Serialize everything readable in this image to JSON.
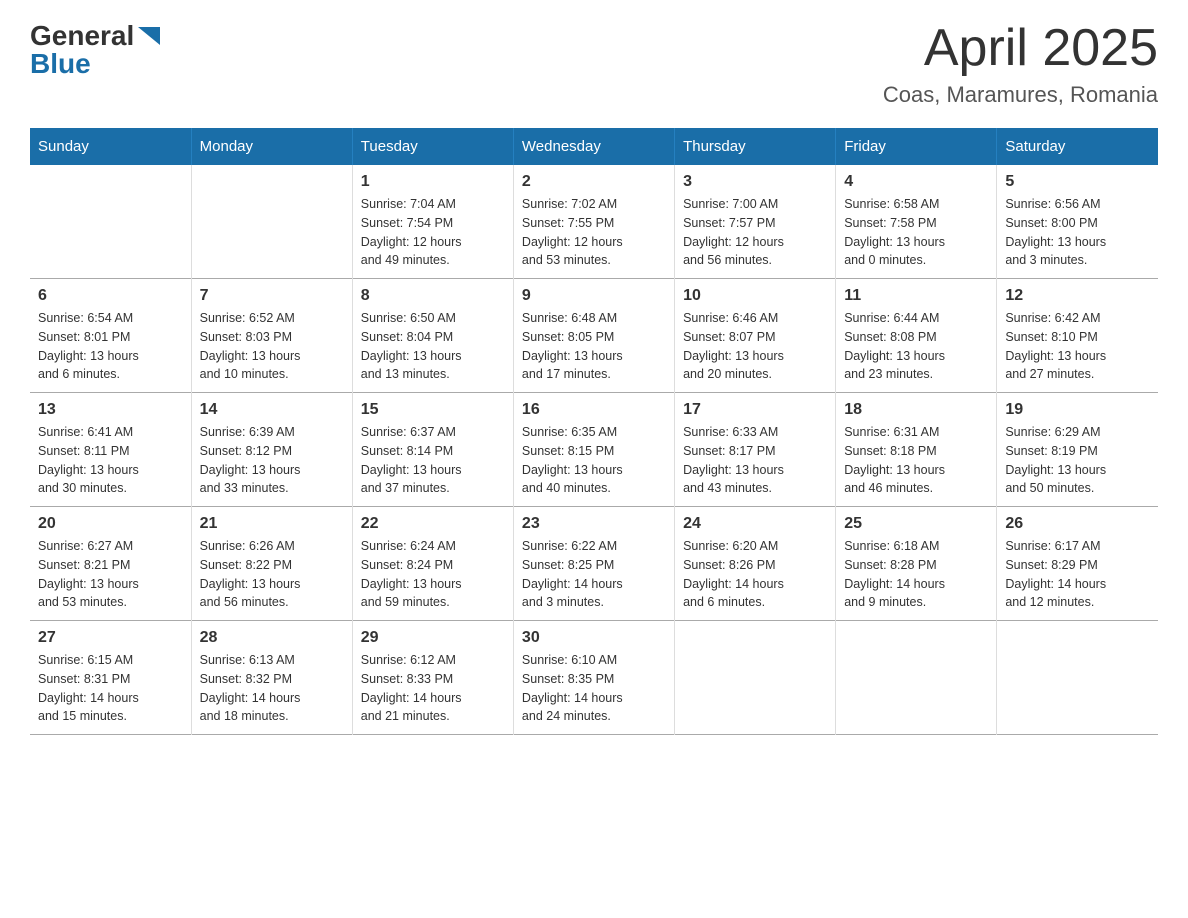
{
  "logo": {
    "general": "General",
    "blue": "Blue"
  },
  "title": "April 2025",
  "subtitle": "Coas, Maramures, Romania",
  "days_header": [
    "Sunday",
    "Monday",
    "Tuesday",
    "Wednesday",
    "Thursday",
    "Friday",
    "Saturday"
  ],
  "weeks": [
    [
      {
        "day": "",
        "info": ""
      },
      {
        "day": "",
        "info": ""
      },
      {
        "day": "1",
        "info": "Sunrise: 7:04 AM\nSunset: 7:54 PM\nDaylight: 12 hours\nand 49 minutes."
      },
      {
        "day": "2",
        "info": "Sunrise: 7:02 AM\nSunset: 7:55 PM\nDaylight: 12 hours\nand 53 minutes."
      },
      {
        "day": "3",
        "info": "Sunrise: 7:00 AM\nSunset: 7:57 PM\nDaylight: 12 hours\nand 56 minutes."
      },
      {
        "day": "4",
        "info": "Sunrise: 6:58 AM\nSunset: 7:58 PM\nDaylight: 13 hours\nand 0 minutes."
      },
      {
        "day": "5",
        "info": "Sunrise: 6:56 AM\nSunset: 8:00 PM\nDaylight: 13 hours\nand 3 minutes."
      }
    ],
    [
      {
        "day": "6",
        "info": "Sunrise: 6:54 AM\nSunset: 8:01 PM\nDaylight: 13 hours\nand 6 minutes."
      },
      {
        "day": "7",
        "info": "Sunrise: 6:52 AM\nSunset: 8:03 PM\nDaylight: 13 hours\nand 10 minutes."
      },
      {
        "day": "8",
        "info": "Sunrise: 6:50 AM\nSunset: 8:04 PM\nDaylight: 13 hours\nand 13 minutes."
      },
      {
        "day": "9",
        "info": "Sunrise: 6:48 AM\nSunset: 8:05 PM\nDaylight: 13 hours\nand 17 minutes."
      },
      {
        "day": "10",
        "info": "Sunrise: 6:46 AM\nSunset: 8:07 PM\nDaylight: 13 hours\nand 20 minutes."
      },
      {
        "day": "11",
        "info": "Sunrise: 6:44 AM\nSunset: 8:08 PM\nDaylight: 13 hours\nand 23 minutes."
      },
      {
        "day": "12",
        "info": "Sunrise: 6:42 AM\nSunset: 8:10 PM\nDaylight: 13 hours\nand 27 minutes."
      }
    ],
    [
      {
        "day": "13",
        "info": "Sunrise: 6:41 AM\nSunset: 8:11 PM\nDaylight: 13 hours\nand 30 minutes."
      },
      {
        "day": "14",
        "info": "Sunrise: 6:39 AM\nSunset: 8:12 PM\nDaylight: 13 hours\nand 33 minutes."
      },
      {
        "day": "15",
        "info": "Sunrise: 6:37 AM\nSunset: 8:14 PM\nDaylight: 13 hours\nand 37 minutes."
      },
      {
        "day": "16",
        "info": "Sunrise: 6:35 AM\nSunset: 8:15 PM\nDaylight: 13 hours\nand 40 minutes."
      },
      {
        "day": "17",
        "info": "Sunrise: 6:33 AM\nSunset: 8:17 PM\nDaylight: 13 hours\nand 43 minutes."
      },
      {
        "day": "18",
        "info": "Sunrise: 6:31 AM\nSunset: 8:18 PM\nDaylight: 13 hours\nand 46 minutes."
      },
      {
        "day": "19",
        "info": "Sunrise: 6:29 AM\nSunset: 8:19 PM\nDaylight: 13 hours\nand 50 minutes."
      }
    ],
    [
      {
        "day": "20",
        "info": "Sunrise: 6:27 AM\nSunset: 8:21 PM\nDaylight: 13 hours\nand 53 minutes."
      },
      {
        "day": "21",
        "info": "Sunrise: 6:26 AM\nSunset: 8:22 PM\nDaylight: 13 hours\nand 56 minutes."
      },
      {
        "day": "22",
        "info": "Sunrise: 6:24 AM\nSunset: 8:24 PM\nDaylight: 13 hours\nand 59 minutes."
      },
      {
        "day": "23",
        "info": "Sunrise: 6:22 AM\nSunset: 8:25 PM\nDaylight: 14 hours\nand 3 minutes."
      },
      {
        "day": "24",
        "info": "Sunrise: 6:20 AM\nSunset: 8:26 PM\nDaylight: 14 hours\nand 6 minutes."
      },
      {
        "day": "25",
        "info": "Sunrise: 6:18 AM\nSunset: 8:28 PM\nDaylight: 14 hours\nand 9 minutes."
      },
      {
        "day": "26",
        "info": "Sunrise: 6:17 AM\nSunset: 8:29 PM\nDaylight: 14 hours\nand 12 minutes."
      }
    ],
    [
      {
        "day": "27",
        "info": "Sunrise: 6:15 AM\nSunset: 8:31 PM\nDaylight: 14 hours\nand 15 minutes."
      },
      {
        "day": "28",
        "info": "Sunrise: 6:13 AM\nSunset: 8:32 PM\nDaylight: 14 hours\nand 18 minutes."
      },
      {
        "day": "29",
        "info": "Sunrise: 6:12 AM\nSunset: 8:33 PM\nDaylight: 14 hours\nand 21 minutes."
      },
      {
        "day": "30",
        "info": "Sunrise: 6:10 AM\nSunset: 8:35 PM\nDaylight: 14 hours\nand 24 minutes."
      },
      {
        "day": "",
        "info": ""
      },
      {
        "day": "",
        "info": ""
      },
      {
        "day": "",
        "info": ""
      }
    ]
  ]
}
